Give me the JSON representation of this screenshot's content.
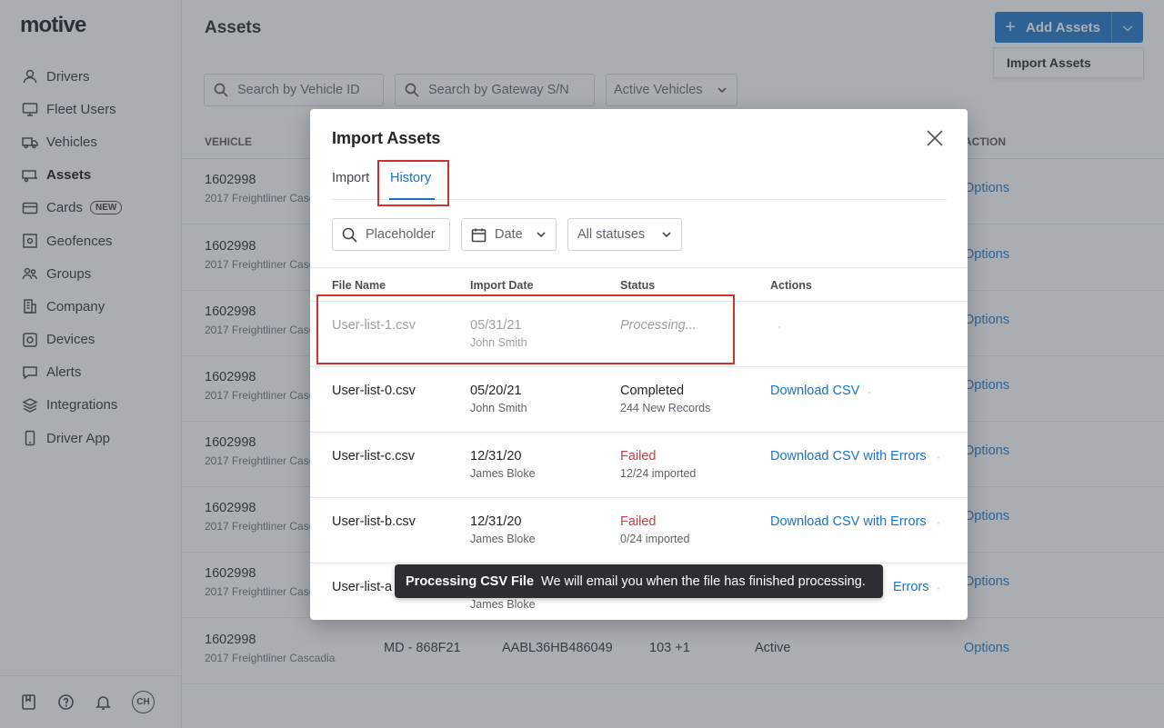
{
  "app": {
    "logo": "motive",
    "page_title": "Assets",
    "add_button": "Add Assets",
    "import_menu_item": "Import Assets"
  },
  "sidebar": {
    "items": [
      {
        "label": "Drivers"
      },
      {
        "label": "Fleet Users"
      },
      {
        "label": "Vehicles"
      },
      {
        "label": "Assets"
      },
      {
        "label": "Cards",
        "badge": "NEW"
      },
      {
        "label": "Geofences"
      },
      {
        "label": "Groups"
      },
      {
        "label": "Company"
      },
      {
        "label": "Devices"
      },
      {
        "label": "Alerts"
      },
      {
        "label": "Integrations"
      },
      {
        "label": "Driver App"
      }
    ],
    "footer_avatar": "CH"
  },
  "filters": {
    "vehicle_search_placeholder": "Search by Vehicle ID",
    "gateway_search_placeholder": "Search by Gateway S/N",
    "status_filter": "Active Vehicles"
  },
  "background_table": {
    "col_vehicle": "VEHICLE",
    "col_action": "ACTION",
    "row_vehicle": "1602998",
    "row_sub": "2017 Freightliner Cascadia",
    "option_label": "Options",
    "last_row": {
      "plate": "MD - 868F21",
      "vin": "AABL36HB486049",
      "count": "103 +1",
      "status": "Active"
    }
  },
  "modal": {
    "title": "Import Assets",
    "tabs": [
      "Import",
      "History"
    ],
    "search_placeholder": "Placeholder",
    "date_filter": "Date",
    "status_filter": "All statuses",
    "columns": [
      "File Name",
      "Import Date",
      "Status",
      "Actions"
    ],
    "rows": [
      {
        "file": "User-list-1.csv",
        "date": "05/31/21",
        "by": "John Smith",
        "status": "Processing...",
        "detail": "",
        "action": ""
      },
      {
        "file": "User-list-0.csv",
        "date": "05/20/21",
        "by": "John Smith",
        "status": "Completed",
        "detail": "244 New Records",
        "action": "Download CSV"
      },
      {
        "file": "User-list-c.csv",
        "date": "12/31/20",
        "by": "James Bloke",
        "status": "Failed",
        "detail": "12/24 imported",
        "action": "Download CSV with Errors"
      },
      {
        "file": "User-list-b.csv",
        "date": "12/31/20",
        "by": "James Bloke",
        "status": "Failed",
        "detail": "0/24 imported",
        "action": "Download CSV with Errors"
      },
      {
        "file": "User-list-a",
        "date": "",
        "by": "James Bloke",
        "status": "",
        "detail": "",
        "action": "Errors"
      }
    ]
  },
  "toast": {
    "title": "Processing CSV File",
    "message": "We will email you when the file has finished processing."
  },
  "colors": {
    "accent": "#1a73c9",
    "danger": "#d63a3a",
    "highlight_box": "#d32f2f"
  }
}
